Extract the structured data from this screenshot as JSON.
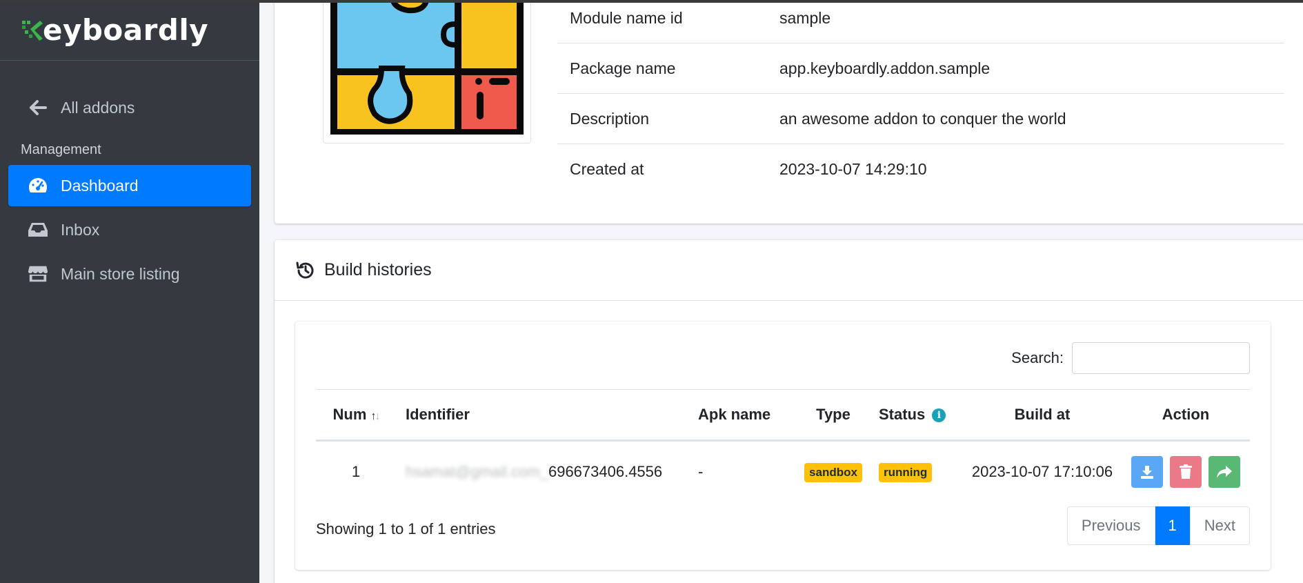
{
  "brand": {
    "name": "eyboardly"
  },
  "sidebar": {
    "back_label": "All addons",
    "section_header": "Management",
    "items": [
      {
        "label": "Dashboard",
        "icon": "dashboard-icon",
        "active": true
      },
      {
        "label": "Inbox",
        "icon": "inbox-icon",
        "active": false
      },
      {
        "label": "Main store listing",
        "icon": "store-icon",
        "active": false
      }
    ]
  },
  "addon_info": {
    "rows": [
      {
        "key": "Module name id",
        "value": "sample"
      },
      {
        "key": "Package name",
        "value": "app.keyboardly.addon.sample"
      },
      {
        "key": "Description",
        "value": "an awesome addon to conquer the world"
      },
      {
        "key": "Created at",
        "value": "2023-10-07 14:29:10"
      }
    ]
  },
  "build_histories": {
    "title": "Build histories",
    "search_label": "Search:",
    "search_value": "",
    "columns": [
      "Num",
      "Identifier",
      "Apk name",
      "Type",
      "Status",
      "Build at",
      "Action"
    ],
    "rows": [
      {
        "num": "1",
        "identifier_hidden": "hsamat@gmail.com_",
        "identifier_visible": "696673406.4556",
        "apk_name": "-",
        "type": "sandbox",
        "status": "running",
        "build_at": "2023-10-07 17:10:06"
      }
    ],
    "info_text": "Showing 1 to 1 of 1 entries",
    "pagination": {
      "previous": "Previous",
      "current": "1",
      "next": "Next"
    }
  },
  "colors": {
    "sidebar_bg": "#343a40",
    "primary": "#007bff",
    "badge_warning": "#ffc107",
    "info": "#17a2b8"
  }
}
